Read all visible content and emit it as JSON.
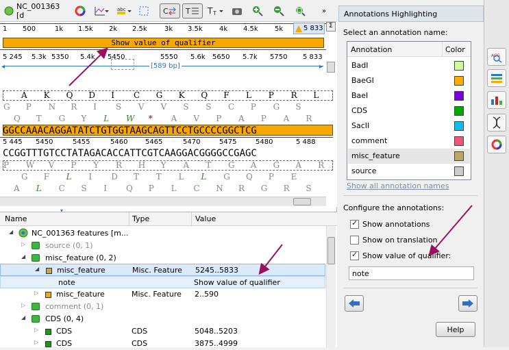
{
  "toolbar": {
    "seq_name": "NC_001363 [d",
    "position_badge": "5 833"
  },
  "overview_ruler": [
    "1",
    "500",
    "1k",
    "1.5k",
    "2k",
    "2.5k",
    "3k",
    "3.5k",
    "4k",
    "4.5k",
    "5k"
  ],
  "qualifier_bar_label": "Show value of qualifier",
  "detail_ruler": [
    "5 245",
    "5.3k",
    "5350",
    "5.4k",
    "5450",
    "5550",
    "5.6k",
    "5650",
    "5.7k",
    "5750",
    "5 833"
  ],
  "selection_span": "[589 bp]",
  "frame_top": [
    "A",
    "K",
    "Q",
    "D",
    "I",
    "C",
    "G",
    "K",
    "Q",
    "F",
    "L",
    "P",
    "R",
    "L"
  ],
  "frame2": [
    "G",
    "P",
    "N",
    "R",
    "I",
    "S",
    "V",
    "V",
    "S",
    "S",
    "C",
    "P",
    "G",
    "S"
  ],
  "frame3": [
    "Q",
    "T",
    "G",
    "Y",
    "L",
    "W",
    "*",
    "A",
    "V",
    "P",
    "A",
    "P",
    "A",
    "R"
  ],
  "dna_forward": "GGCCAAACAGGATATCTGTGGTAAGCAGTTCCTGCCCCGGCTCG",
  "seq_ruler": [
    "5 445",
    "5450",
    "5455",
    "5460",
    "5465",
    "5470",
    "5475",
    "5480",
    "5 488"
  ],
  "dna_reverse": "CCGGTTTGTCCTATAGACACCATTCGTCAAGGACGGGGCCGAGC",
  "rframe1": [
    "P",
    "W",
    "V",
    "P",
    "Y",
    "R",
    "H",
    "Y",
    "A",
    "T",
    "G",
    "A",
    "G",
    "A",
    "R"
  ],
  "rframe2": [
    "G",
    "F",
    "L",
    "I",
    "D",
    "T",
    "T",
    "L",
    "L",
    "G",
    "Q",
    "P",
    "E"
  ],
  "rframe3": [
    "A",
    "L",
    "C",
    "S",
    "I",
    "Q",
    "P",
    "L",
    "C",
    "N",
    "R",
    "G",
    "R",
    "S"
  ],
  "tree": {
    "headers": {
      "name": "Name",
      "type": "Type",
      "value": "Value"
    },
    "rows": [
      {
        "name": "NC_001363 features [m...",
        "type": "",
        "value": ""
      },
      {
        "name": "source  (0, 1)",
        "type": "",
        "value": ""
      },
      {
        "name": "misc_feature  (0, 2)",
        "type": "",
        "value": ""
      },
      {
        "name": "misc_feature",
        "type": "Misc. Feature",
        "value": "5245..5833"
      },
      {
        "name": "note",
        "type": "",
        "value": "Show value of qualifier"
      },
      {
        "name": "misc_feature",
        "type": "Misc. Feature",
        "value": "2..590"
      },
      {
        "name": "comment  (0, 1)",
        "type": "",
        "value": ""
      },
      {
        "name": "CDS  (0, 4)",
        "type": "",
        "value": ""
      },
      {
        "name": "CDS",
        "type": "CDS",
        "value": "5048..5203"
      },
      {
        "name": "CDS",
        "type": "CDS",
        "value": "3875..4999"
      }
    ]
  },
  "panel": {
    "title": "Annotations Highlighting",
    "select_label": "Select an annotation name:",
    "col_annotation": "Annotation",
    "col_color": "Color",
    "annotations": [
      {
        "name": "BadI",
        "color": "#ccff99"
      },
      {
        "name": "BaeGI",
        "color": "#ffaa00"
      },
      {
        "name": "BaeI",
        "color": "#7700dd"
      },
      {
        "name": "CDS",
        "color": "#00aa00"
      },
      {
        "name": "SacII",
        "color": "#11bbee"
      },
      {
        "name": "comment",
        "color": "#ee5577"
      },
      {
        "name": "misc_feature",
        "color": "#bba866"
      },
      {
        "name": "source",
        "color": "#cccccc"
      }
    ],
    "show_all_link": "Show all annotation names",
    "configure_label": "Configure the annotations:",
    "show_annotations": "Show annotations",
    "show_on_translation": "Show on translation",
    "show_value_of_qualifier": "Show value of qualifier:",
    "qualifier_value": "note",
    "help_label": "Help"
  }
}
